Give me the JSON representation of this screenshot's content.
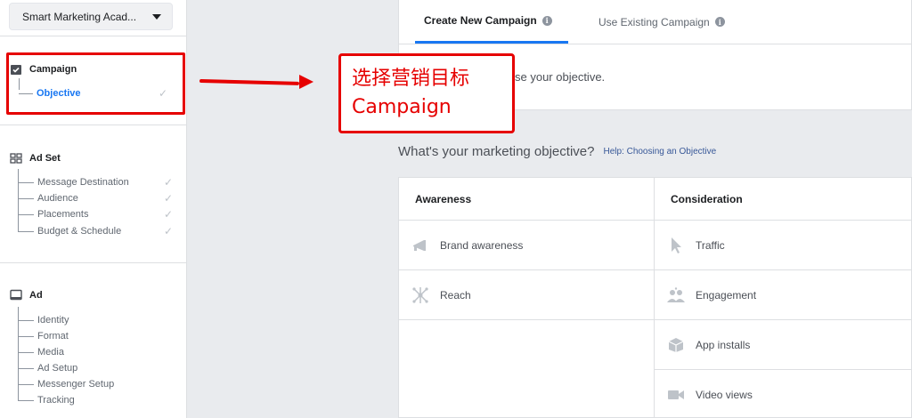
{
  "sidebar": {
    "account_name": "Smart Marketing Acad...",
    "campaign": {
      "title": "Campaign",
      "items": [
        {
          "label": "Objective",
          "checked": true
        }
      ]
    },
    "adset": {
      "title": "Ad Set",
      "items": [
        {
          "label": "Message Destination",
          "checked": true
        },
        {
          "label": "Audience",
          "checked": true
        },
        {
          "label": "Placements",
          "checked": true
        },
        {
          "label": "Budget & Schedule",
          "checked": true
        }
      ]
    },
    "ad": {
      "title": "Ad",
      "items": [
        {
          "label": "Identity"
        },
        {
          "label": "Format"
        },
        {
          "label": "Media"
        },
        {
          "label": "Ad Setup"
        },
        {
          "label": "Messenger Setup"
        },
        {
          "label": "Tracking"
        }
      ]
    }
  },
  "annotation": {
    "line1": "选择营销目标",
    "line2": "Campaign"
  },
  "tabs": {
    "create_new": "Create New Campaign",
    "use_existing": "Use Existing Campaign"
  },
  "objective_prompt": "se your objective.",
  "question": "What's your marketing objective?",
  "help_link": "Help: Choosing an Objective",
  "columns": {
    "awareness": {
      "title": "Awareness",
      "items": [
        {
          "label": "Brand awareness",
          "icon": "megaphone-icon"
        },
        {
          "label": "Reach",
          "icon": "network-icon"
        }
      ]
    },
    "consideration": {
      "title": "Consideration",
      "items": [
        {
          "label": "Traffic",
          "icon": "cursor-icon"
        },
        {
          "label": "Engagement",
          "icon": "people-icon"
        },
        {
          "label": "App installs",
          "icon": "box-icon"
        },
        {
          "label": "Video views",
          "icon": "video-camera-icon"
        }
      ]
    }
  },
  "colors": {
    "accent": "#1877f2",
    "link": "#385898",
    "annotation_red": "#e60000",
    "icon_gray": "#bec3c9"
  }
}
